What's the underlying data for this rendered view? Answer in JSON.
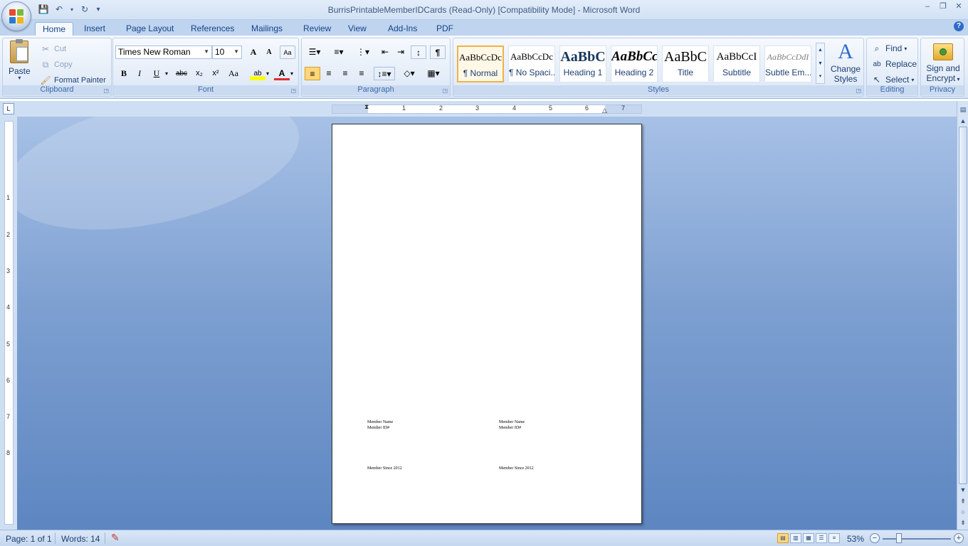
{
  "window": {
    "title": "BurrisPrintableMemberIDCards (Read-Only) [Compatibility Mode] - Microsoft Word",
    "minimize": "–",
    "maximize": "❐",
    "close": "✕"
  },
  "qat": {
    "save": "💾",
    "undo": "↶",
    "redo": "↻",
    "customize": "▾"
  },
  "tabs": [
    "Home",
    "Insert",
    "Page Layout",
    "References",
    "Mailings",
    "Review",
    "View",
    "Add-Ins",
    "PDF"
  ],
  "help": "?",
  "clipboard": {
    "label": "Clipboard",
    "paste": "Paste",
    "cut": "Cut",
    "copy": "Copy",
    "format_painter": "Format Painter"
  },
  "font": {
    "label": "Font",
    "family": "Times New Roman",
    "size": "10",
    "grow": "A",
    "shrink": "A",
    "clear": "Aa",
    "bold": "B",
    "italic": "I",
    "underline": "U",
    "strike": "abc",
    "subscript": "x₂",
    "superscript": "x²",
    "change_case": "Aa",
    "highlight": "ab",
    "font_color": "A"
  },
  "paragraph": {
    "label": "Paragraph",
    "show_marks": "¶"
  },
  "styles": {
    "label": "Styles",
    "items": [
      {
        "sample": "AaBbCcDc",
        "name": "¶ Normal"
      },
      {
        "sample": "AaBbCcDc",
        "name": "¶ No Spaci..."
      },
      {
        "sample": "AaBbC",
        "name": "Heading 1"
      },
      {
        "sample": "AaBbCc",
        "name": "Heading 2"
      },
      {
        "sample": "AaBbC",
        "name": "Title"
      },
      {
        "sample": "AaBbCcI",
        "name": "Subtitle"
      },
      {
        "sample": "AaBbCcDdI",
        "name": "Subtle Em..."
      }
    ],
    "change_styles_1": "Change",
    "change_styles_2": "Styles"
  },
  "editing": {
    "label": "Editing",
    "find": "Find",
    "replace": "Replace",
    "select": "Select"
  },
  "privacy": {
    "label": "Privacy",
    "sign_1": "Sign and",
    "sign_2": "Encrypt"
  },
  "ruler": {
    "numbers": [
      "1",
      "2",
      "3",
      "4",
      "5",
      "6",
      "7"
    ],
    "vnumbers": [
      "1",
      "2",
      "3",
      "4",
      "5",
      "6",
      "7",
      "8"
    ]
  },
  "document": {
    "cards": [
      {
        "name": "Member Name",
        "id": "Member ID#",
        "since": "Member Since 2012"
      },
      {
        "name": "Member Name",
        "id": "Member ID#",
        "since": "Member Since 2012"
      }
    ]
  },
  "status": {
    "page": "Page: 1 of 1",
    "words": "Words: 14",
    "zoom": "53%"
  }
}
